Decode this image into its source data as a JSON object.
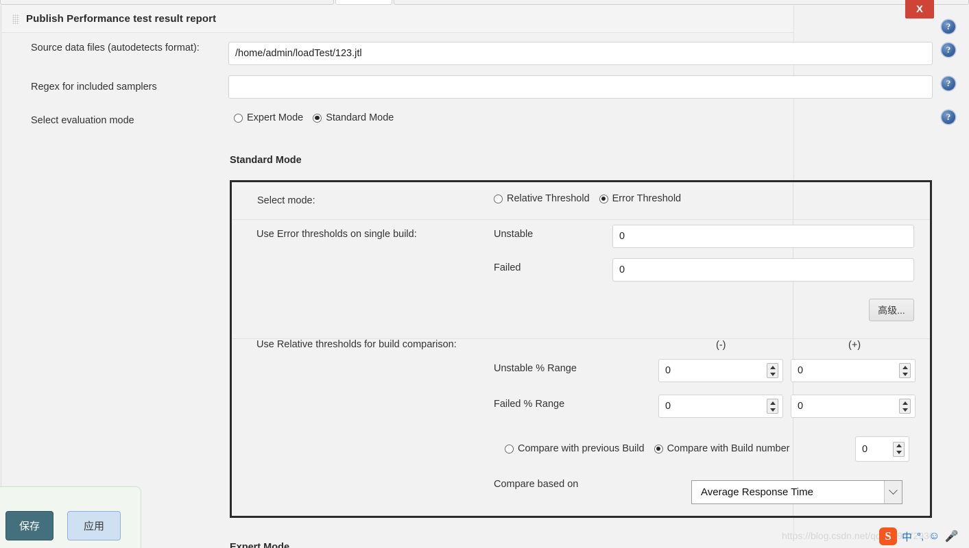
{
  "window": {
    "title": "Publish Performance test result report",
    "close_label": "X",
    "grip_icon": "drag-handle-icon"
  },
  "help": {
    "icon_glyph": "?",
    "icon_name": "help-icon",
    "count": 4
  },
  "fields": {
    "source_data": {
      "label": "Source data files (autodetects format):",
      "value": "/home/admin/loadTest/123.jtl",
      "placeholder": ""
    },
    "regex": {
      "label": "Regex for included samplers",
      "value": "",
      "placeholder": ""
    },
    "evaluation_mode": {
      "label": "Select evaluation mode",
      "options": [
        {
          "label": "Expert Mode",
          "checked": false
        },
        {
          "label": "Standard Mode",
          "checked": true
        }
      ]
    }
  },
  "standard_mode": {
    "heading": "Standard Mode",
    "select_mode": {
      "label": "Select mode:",
      "options": [
        {
          "label": "Relative Threshold",
          "checked": false
        },
        {
          "label": "Error Threshold",
          "checked": true
        }
      ]
    },
    "error_thresholds": {
      "label": "Use Error thresholds on single build:",
      "rows": [
        {
          "label": "Unstable",
          "value": "0"
        },
        {
          "label": "Failed",
          "value": "0"
        }
      ]
    },
    "advanced_button": "高级...",
    "relative_thresholds": {
      "label": "Use Relative thresholds for build comparison:",
      "col_minus": "(-)",
      "col_plus": "(+)",
      "rows": [
        {
          "label": "Unstable % Range",
          "minus": "0",
          "plus": "0"
        },
        {
          "label": "Failed % Range",
          "minus": "0",
          "plus": "0"
        }
      ]
    },
    "compare_with": {
      "options": [
        {
          "label": "Compare with previous Build",
          "checked": false
        },
        {
          "label": "Compare with Build number",
          "checked": true
        }
      ],
      "build_number": "0"
    },
    "compare_based_on": {
      "label": "Compare based on",
      "value": "Average Response Time"
    }
  },
  "expert_mode": {
    "heading": "Expert Mode"
  },
  "footer": {
    "save_label": "保存",
    "apply_label": "应用"
  },
  "overlay": {
    "watermark": "https://blog.csdn.net/qq_u39872936",
    "ime": {
      "logo": "S",
      "lang": "中",
      "punct": "°,",
      "emoji": "☺",
      "mic": "🎤"
    }
  },
  "colors": {
    "accent_red": "#cf4436",
    "save_teal": "#44707d",
    "apply_blue": "#cfe0f2",
    "help_blue": "#3d6aa8",
    "box_border": "#2b2b2b"
  }
}
